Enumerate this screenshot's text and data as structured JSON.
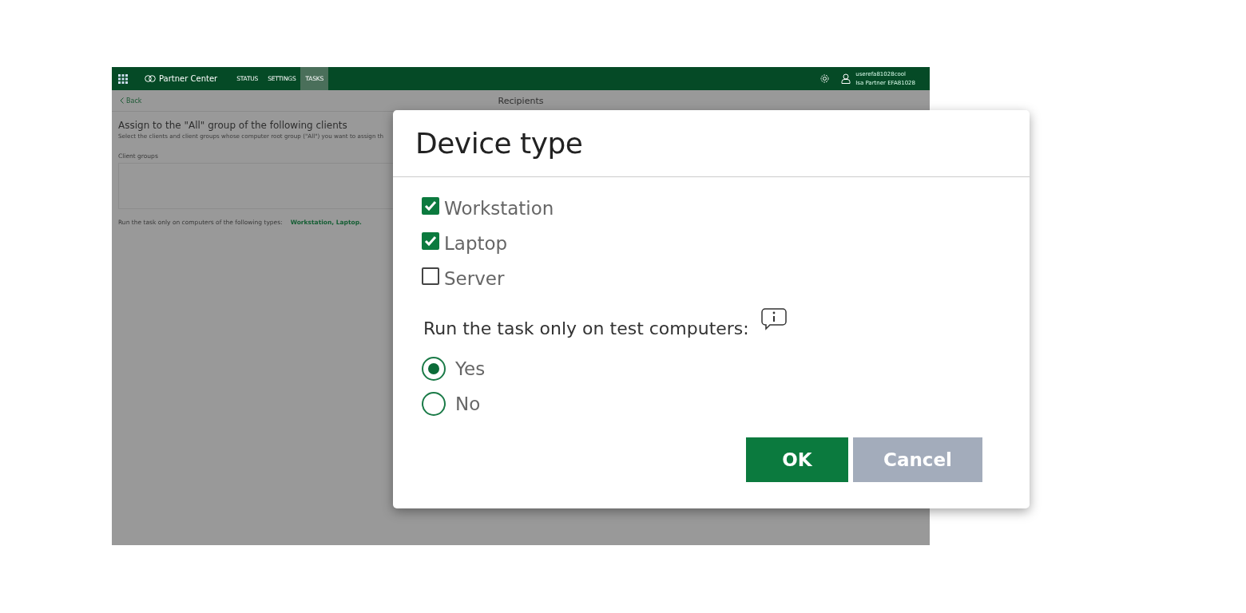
{
  "app": {
    "brand": "Partner Center",
    "nav": [
      {
        "label": "STATUS",
        "selected": false
      },
      {
        "label": "SETTINGS",
        "selected": false
      },
      {
        "label": "TASKS",
        "selected": true
      }
    ],
    "user": {
      "name": "userefa81028cool",
      "role": "Isa Partner EFA81028"
    }
  },
  "page": {
    "back": "Back",
    "title": "Recipients",
    "heading": "Assign to the \"All\" group of the following clients",
    "description": "Select the clients and client groups whose computer root group (\"All\") you want to assign th",
    "client_groups_label": "Client groups",
    "types_label": "Run the task only on computers of the following types:",
    "types_value": "Workstation, Laptop."
  },
  "dialog": {
    "title": "Device type",
    "device_types": [
      {
        "label": "Workstation",
        "checked": true
      },
      {
        "label": "Laptop",
        "checked": true
      },
      {
        "label": "Server",
        "checked": false
      }
    ],
    "test_label": "Run the task only on test computers:",
    "test_options": [
      {
        "label": "Yes",
        "selected": true
      },
      {
        "label": "No",
        "selected": false
      }
    ],
    "buttons": [
      {
        "label": "OK",
        "kind": "primary"
      },
      {
        "label": "Cancel",
        "kind": "secondary"
      }
    ]
  }
}
